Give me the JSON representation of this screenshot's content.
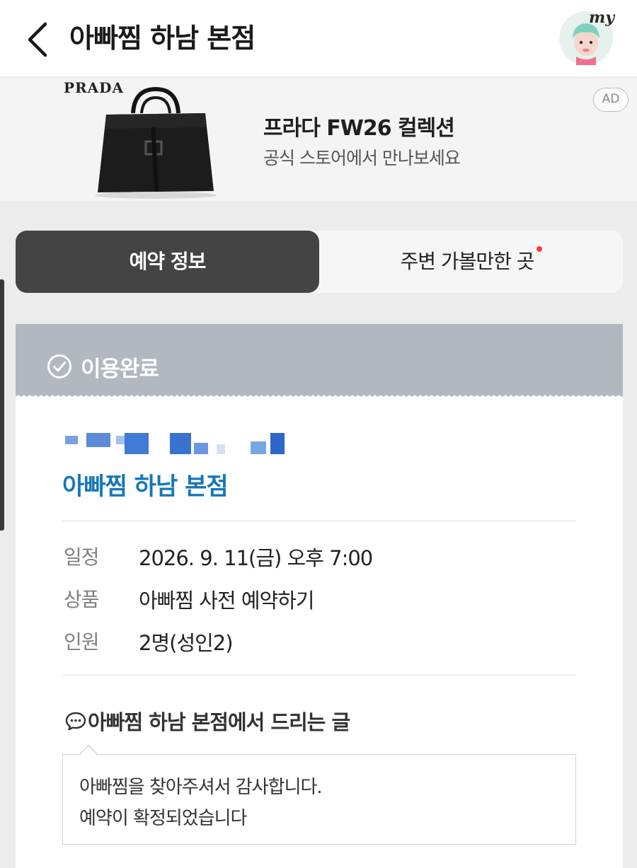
{
  "header": {
    "title": "아빠찜 하남 본점",
    "avatar_text": "my"
  },
  "ad": {
    "brand": "PRADA",
    "title": "프라다 FW26 컬렉션",
    "subtitle": "공식 스토어에서 만나보세요",
    "badge": "AD"
  },
  "tabs": [
    {
      "label": "예약 정보",
      "active": true
    },
    {
      "label": "주변 가볼만한 곳",
      "active": false,
      "has_dot": true
    }
  ],
  "status": {
    "label": "이용완료"
  },
  "reservation": {
    "store_name": "아빠찜 하남 본점",
    "rows": [
      {
        "label": "일정",
        "value": "2026. 9. 11(금) 오후 7:00"
      },
      {
        "label": "상품",
        "value": "아빠찜 사전 예약하기"
      },
      {
        "label": "인원",
        "value": "2명(성인2)"
      }
    ]
  },
  "message": {
    "heading": "아빠찜 하남 본점에서 드리는 글",
    "lines": [
      "아빠찜을 찾아주셔서 감사합니다.",
      "예약이 확정되었습니다"
    ]
  },
  "colors": {
    "accent_blue": "#1677b9",
    "tab_active_bg": "#444444",
    "status_bg": "#b2b8c0",
    "notification_dot": "#ff3b3b"
  }
}
